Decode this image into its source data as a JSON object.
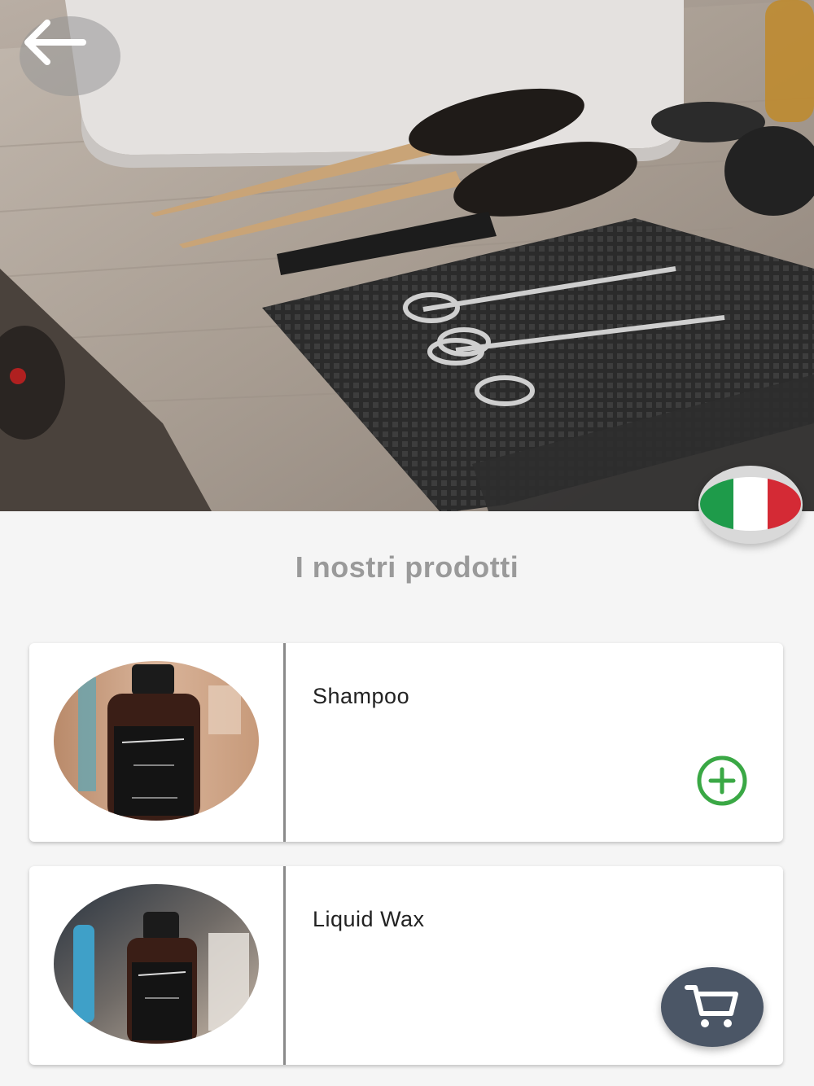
{
  "header": {
    "back_icon": "arrow-left-icon",
    "language_flag": "italy-flag-icon",
    "flag_colors": [
      "#1e9b4a",
      "#ffffff",
      "#d42a35"
    ]
  },
  "main": {
    "title": "I nostri prodotti",
    "products": [
      {
        "name": "Shampoo",
        "action_icon": "plus-circle-icon"
      },
      {
        "name": "Liquid Wax"
      }
    ]
  },
  "fab": {
    "icon": "shopping-cart-icon"
  },
  "colors": {
    "accent_green": "#3aa845",
    "fab_background": "#4b5666",
    "title_gray": "#9a9a9a"
  }
}
